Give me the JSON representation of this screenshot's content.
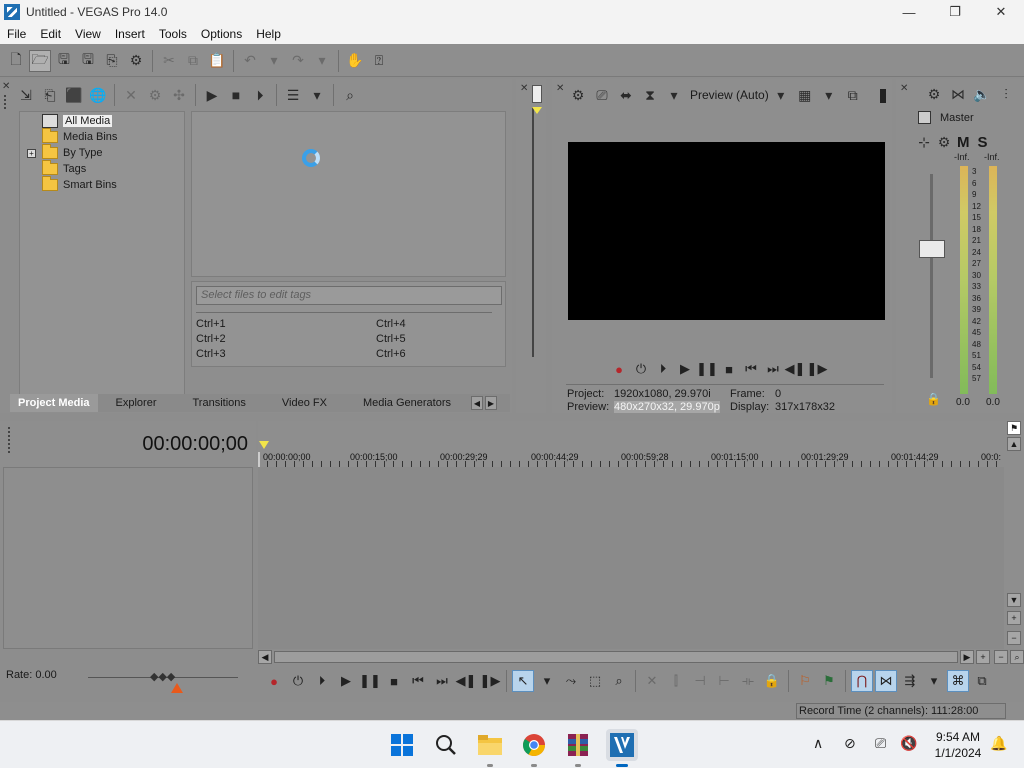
{
  "window": {
    "title": "Untitled - VEGAS Pro 14.0",
    "controls": [
      "—",
      "❐",
      "✕"
    ]
  },
  "menu": [
    "File",
    "Edit",
    "View",
    "Insert",
    "Tools",
    "Options",
    "Help"
  ],
  "project_media": {
    "tree": [
      {
        "label": "All Media",
        "selected": true,
        "icon": "all-media-icon"
      },
      {
        "label": "Media Bins",
        "icon": "folder-icon"
      },
      {
        "label": "By Type",
        "icon": "folder-icon",
        "expandable": true
      },
      {
        "label": "Tags",
        "icon": "folder-icon"
      },
      {
        "label": "Smart Bins",
        "icon": "folder-icon"
      }
    ],
    "tag_placeholder": "Select files to edit tags",
    "shortcuts": [
      "Ctrl+1",
      "Ctrl+4",
      "Ctrl+2",
      "Ctrl+5",
      "Ctrl+3",
      "Ctrl+6"
    ]
  },
  "tabs": [
    "Project Media",
    "Explorer",
    "Transitions",
    "Video FX",
    "Media Generators"
  ],
  "preview": {
    "quality": "Preview (Auto)",
    "project_label": "Project:",
    "project_value": "1920x1080, 29.970i",
    "preview_label": "Preview:",
    "preview_value": "480x270x32, 29.970p",
    "frame_label": "Frame:",
    "frame_value": "0",
    "display_label": "Display:",
    "display_value": "317x178x32"
  },
  "master": {
    "title": "Master",
    "left_peak": "-Inf.",
    "right_peak": "-Inf.",
    "scale": [
      "3",
      "6",
      "9",
      "12",
      "15",
      "18",
      "21",
      "24",
      "27",
      "30",
      "33",
      "36",
      "39",
      "42",
      "45",
      "48",
      "51",
      "54",
      "57"
    ],
    "left_value": "0.0",
    "right_value": "0.0",
    "m_label": "M",
    "s_label": "S"
  },
  "timeline": {
    "timecode": "00:00:00;00",
    "ruler": [
      "00:00:00;00",
      "00:00:15;00",
      "00:00:29;29",
      "00:00:44;29",
      "00:00:59;28",
      "00:01:15;00",
      "00:01:29;29",
      "00:01:44;29",
      "00:0:"
    ]
  },
  "rate": "Rate: 0.00",
  "status": "Record Time (2 channels): 111:28:00",
  "clock": {
    "time": "9:54 AM",
    "date": "1/1/2024"
  }
}
